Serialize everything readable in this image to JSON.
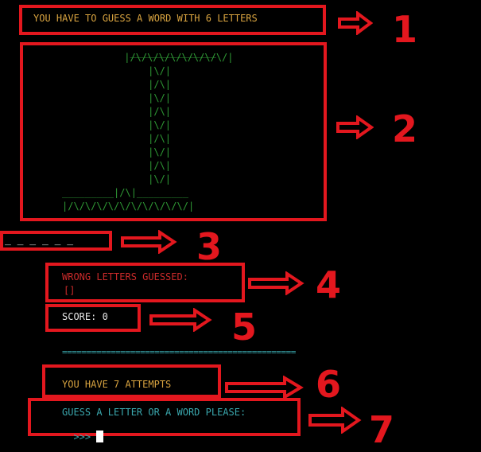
{
  "header": {
    "prompt": "YOU HAVE TO GUESS A WORD WITH 6 LETTERS"
  },
  "gallows": {
    "lines": [
      "  _______________",
      " |/\\/\\/\\/\\/\\/\\/\\/\\/|",
      "     |\\/|",
      "     |/\\|",
      "     |\\/|",
      "     |/\\|",
      "     |\\/|",
      "     |/\\|",
      "     |\\/|",
      "     |/\\|",
      "     |\\/|",
      "_________|/\\|_________",
      "|/\\/\\/\\/\\/\\/\\/\\/\\/\\/\\/|"
    ]
  },
  "word": {
    "blanks": "_ _ _ _ _ _"
  },
  "wrong_letters": {
    "label": "WRONG LETTERS GUESSED:",
    "value": "[]"
  },
  "score": {
    "text": "SCORE: 0"
  },
  "divider": "================================================",
  "attempts": {
    "text": "YOU HAVE 7 ATTEMPTS"
  },
  "input": {
    "prompt": "GUESS A LETTER OR A WORD PLEASE:",
    "caret": ">>>"
  },
  "annotations": [
    "1",
    "2",
    "3",
    "4",
    "5",
    "6",
    "7"
  ],
  "colors": {
    "annotation": "#e3171e",
    "header": "#d9a440",
    "gallows": "#2f9a35",
    "wrong": "#c92a2a",
    "teal": "#3aa7ad"
  }
}
